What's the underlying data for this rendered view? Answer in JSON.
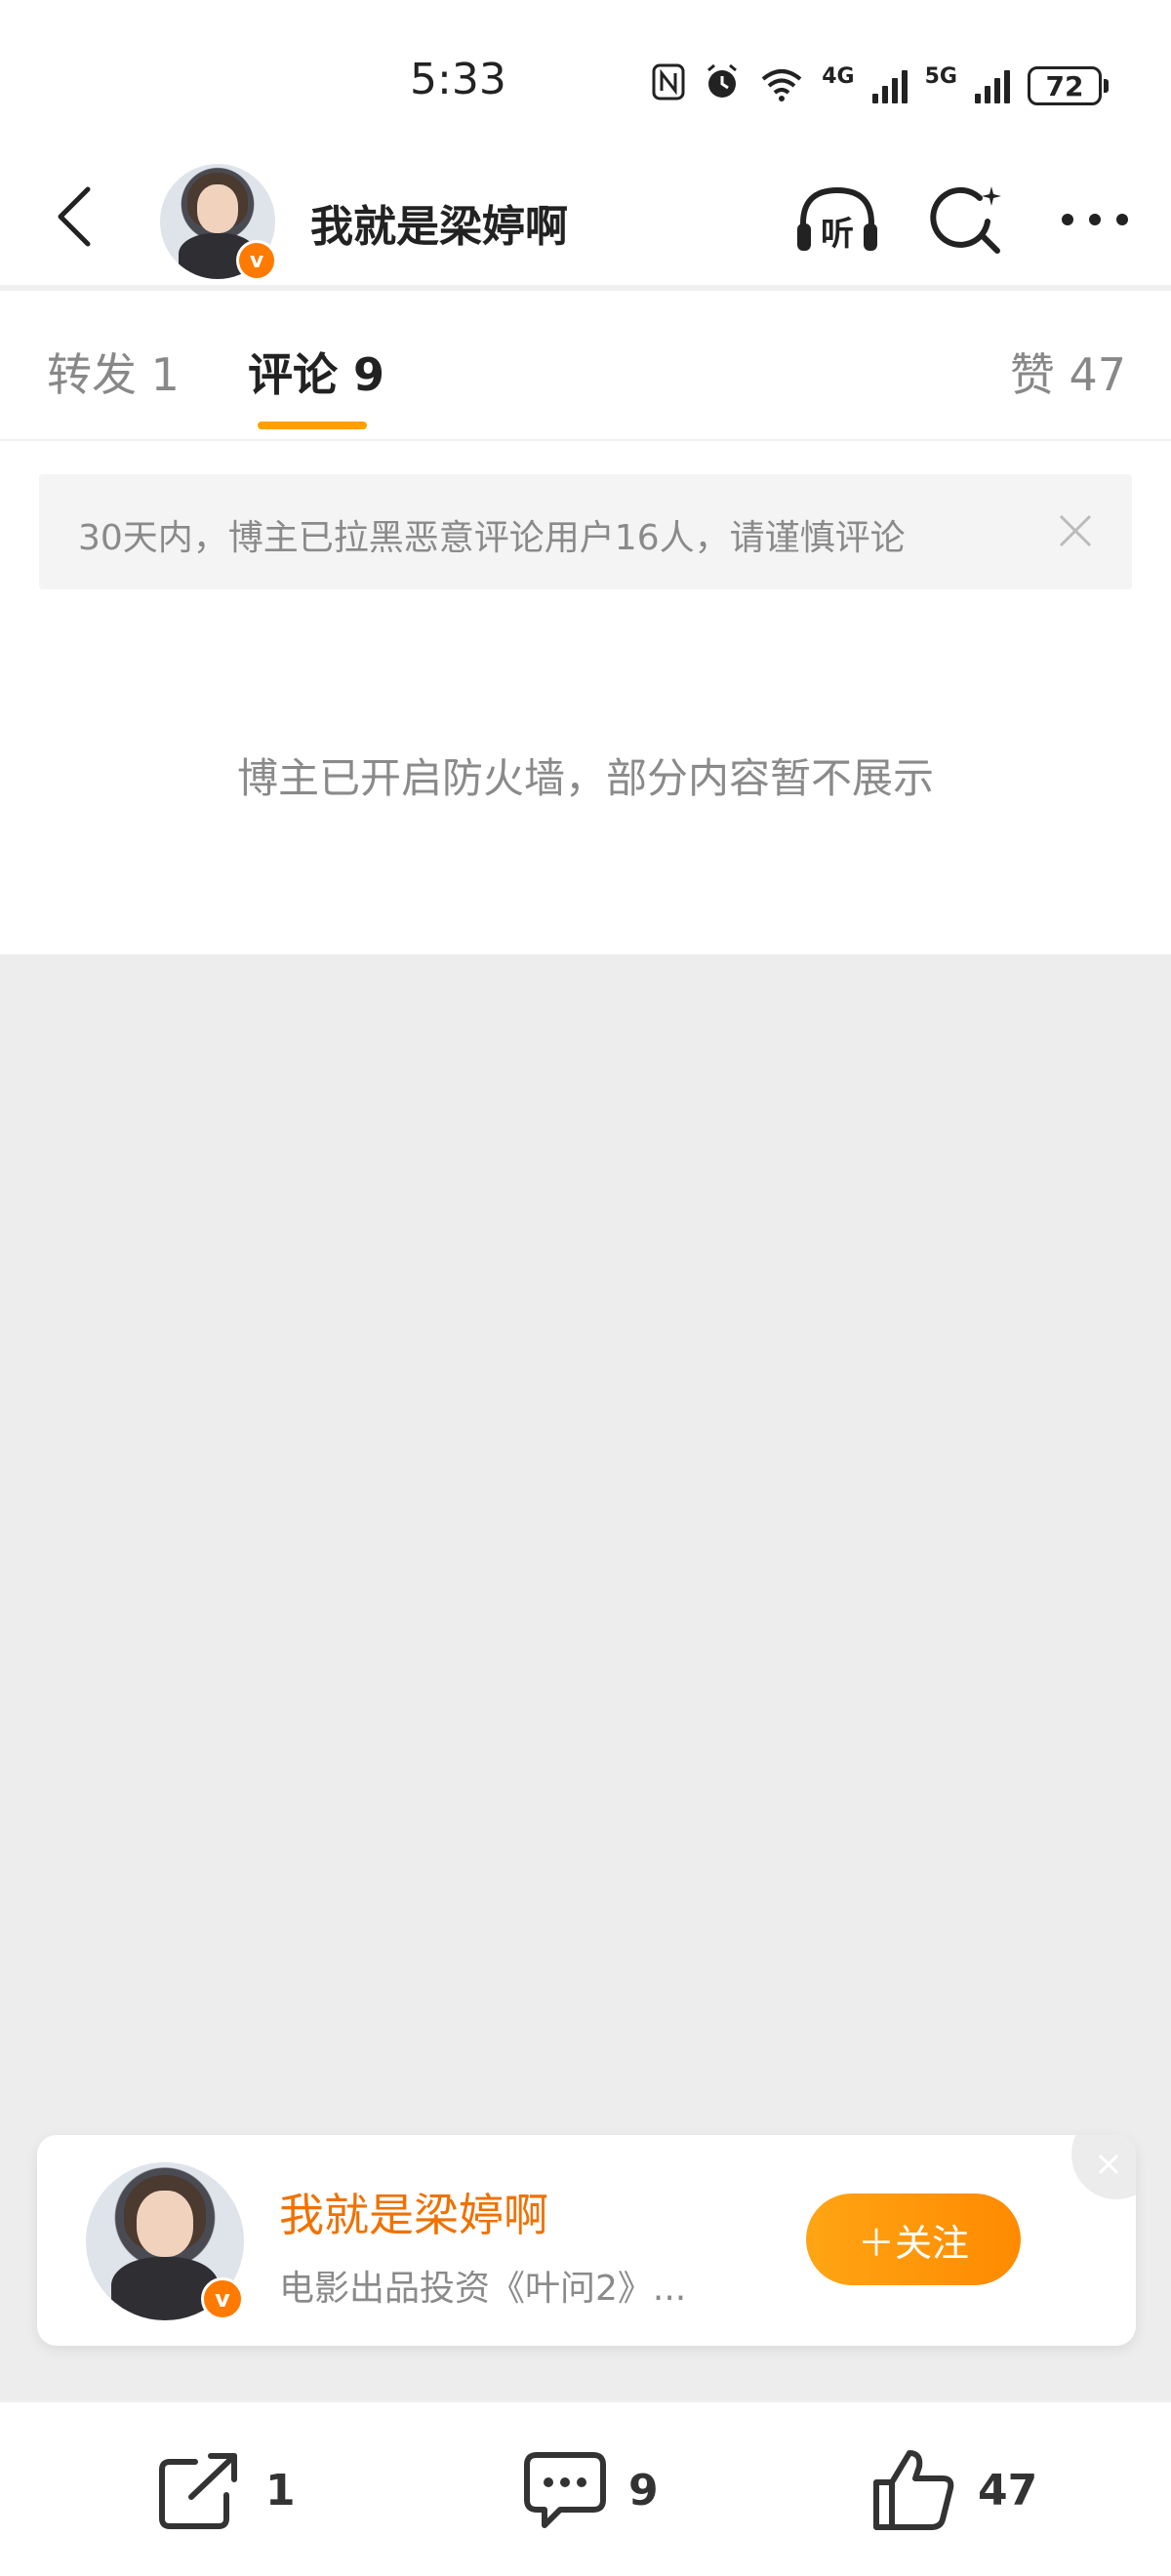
{
  "status_bar": {
    "time": "5:33",
    "network_1": "4G",
    "network_2": "5G",
    "battery": "72",
    "icons": [
      "nfc-icon",
      "alarm-icon",
      "wifi-icon",
      "signal-4g-icon",
      "signal-5g-icon",
      "battery-icon"
    ]
  },
  "header": {
    "title": "我就是梁婷啊",
    "verified_badge": "v",
    "listen_label": "听",
    "icons": [
      "back-icon",
      "listen-icon",
      "search-icon",
      "more-icon"
    ]
  },
  "tabs": {
    "repost": "转发 1",
    "comment": "评论 9",
    "like": "赞 47",
    "active": "comment"
  },
  "notice": {
    "text": "30天内，博主已拉黑恶意评论用户16人，请谨慎评论"
  },
  "firewall_message": "博主已开启防火墙，部分内容暂不展示",
  "follow_card": {
    "name": "我就是梁婷啊",
    "description": "电影出品投资《叶问2》...",
    "follow_button": "＋关注",
    "verified_badge": "v"
  },
  "bottom_bar": {
    "repost_count": "1",
    "comment_count": "9",
    "like_count": "47"
  },
  "colors": {
    "accent_orange": "#ff8a00",
    "name_orange": "#f07100",
    "tab_underline": "#ff9f00",
    "grey_background": "#ededed"
  }
}
